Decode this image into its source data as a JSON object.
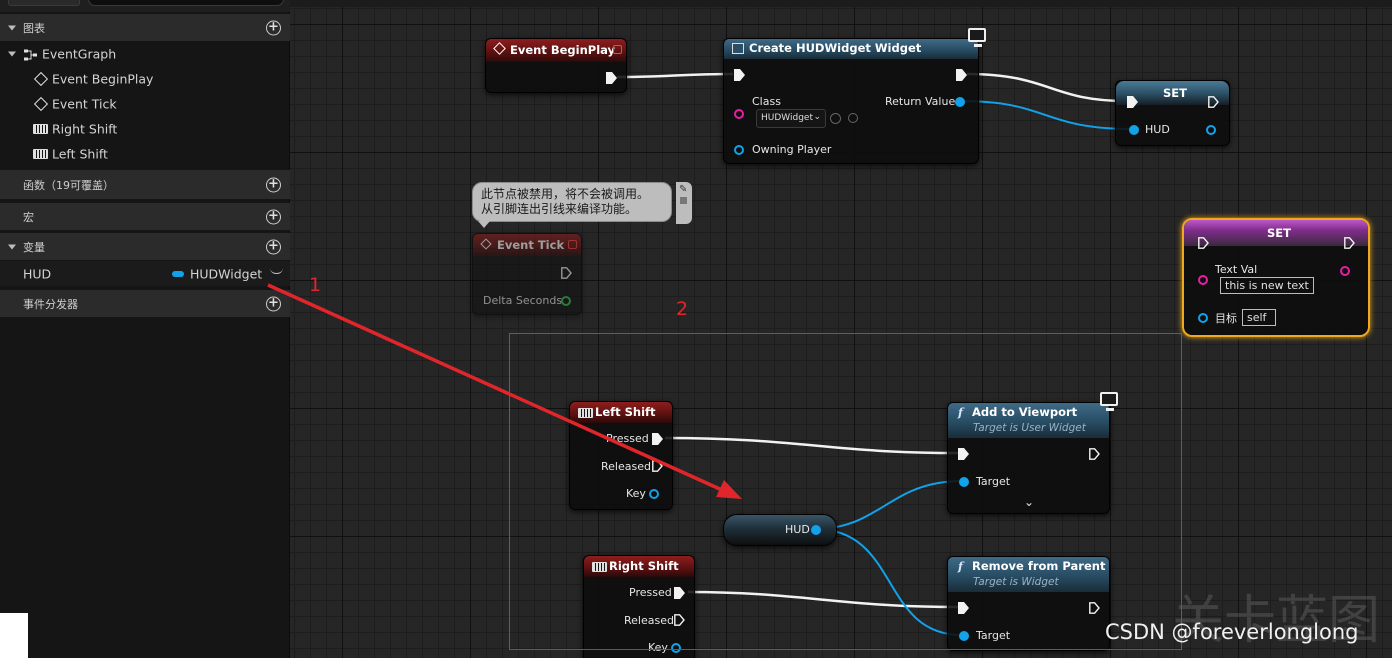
{
  "left_panel": {
    "sections": {
      "graphs": "图表",
      "functions": "函数（19可覆盖）",
      "macros": "宏",
      "variables": "变量",
      "dispatchers": "事件分发器"
    },
    "graph_tree": {
      "root": "EventGraph",
      "items": [
        "Event BeginPlay",
        "Event Tick",
        "Right Shift",
        "Left Shift"
      ]
    },
    "variable": {
      "name": "HUD",
      "type": "HUDWidget"
    }
  },
  "nodes": {
    "event_beginplay": {
      "title": "Event BeginPlay"
    },
    "create_widget": {
      "title": "Create HUDWidget Widget",
      "class_label": "Class",
      "class_value": "HUDWidget",
      "return_label": "Return Value",
      "owning_player": "Owning Player"
    },
    "set_hud": {
      "title": "SET",
      "pin_label": "HUD"
    },
    "event_tick": {
      "title": "Event Tick",
      "delta": "Delta Seconds"
    },
    "disabled_comment": {
      "line1": "此节点被禁用，将不会被调用。",
      "line2": "从引脚连出引线来编译功能。"
    },
    "set_text": {
      "title": "SET",
      "text_label": "Text Val",
      "text_value": "this is new text",
      "target_label": "目标",
      "target_value": "self"
    },
    "left_shift": {
      "title": "Left Shift",
      "pressed": "Pressed",
      "released": "Released",
      "key": "Key"
    },
    "right_shift": {
      "title": "Right Shift",
      "pressed": "Pressed",
      "released": "Released",
      "key": "Key"
    },
    "hud_getter": {
      "label": "HUD"
    },
    "add_to_viewport": {
      "title": "Add to Viewport",
      "subtitle": "Target is User Widget",
      "target": "Target",
      "expand": "⌄"
    },
    "remove_from_parent": {
      "title": "Remove from Parent",
      "subtitle": "Target is Widget",
      "target": "Target"
    }
  },
  "annotations": {
    "label1": "1",
    "label2": "2"
  },
  "watermark": "CSDN @foreverlonglong",
  "ghost_text": "关卡蓝图"
}
